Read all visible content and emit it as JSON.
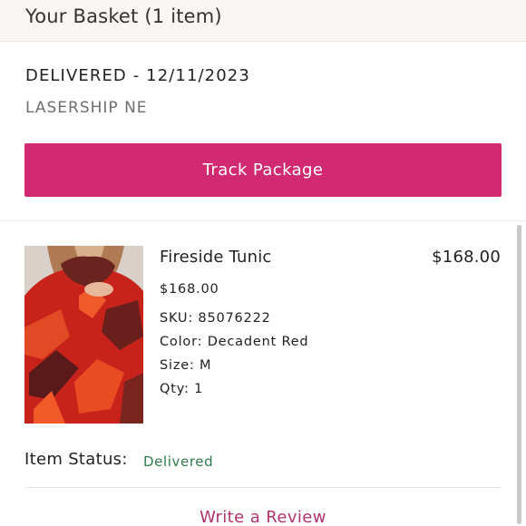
{
  "header": {
    "title": "Your Basket (1 item)"
  },
  "shipment": {
    "status": "DELIVERED - 12/11/2023",
    "carrier": "LASERSHIP NE",
    "track_label": "Track Package"
  },
  "item": {
    "name": "Fireside Tunic",
    "total": "$168.00",
    "price": "$168.00",
    "sku": "SKU: 85076222",
    "color": "Color: Decadent Red",
    "size": "Size: M",
    "qty": "Qty: 1",
    "image_icon": "product-photo-sweater"
  },
  "item_status": {
    "label": "Item Status:",
    "value": "Delivered"
  },
  "actions": {
    "review_label": "Write a Review"
  },
  "colors": {
    "accent": "#d12a72",
    "review_link": "#b0336e",
    "status_green": "#2e7d4a",
    "header_bg": "#faf6f3"
  }
}
